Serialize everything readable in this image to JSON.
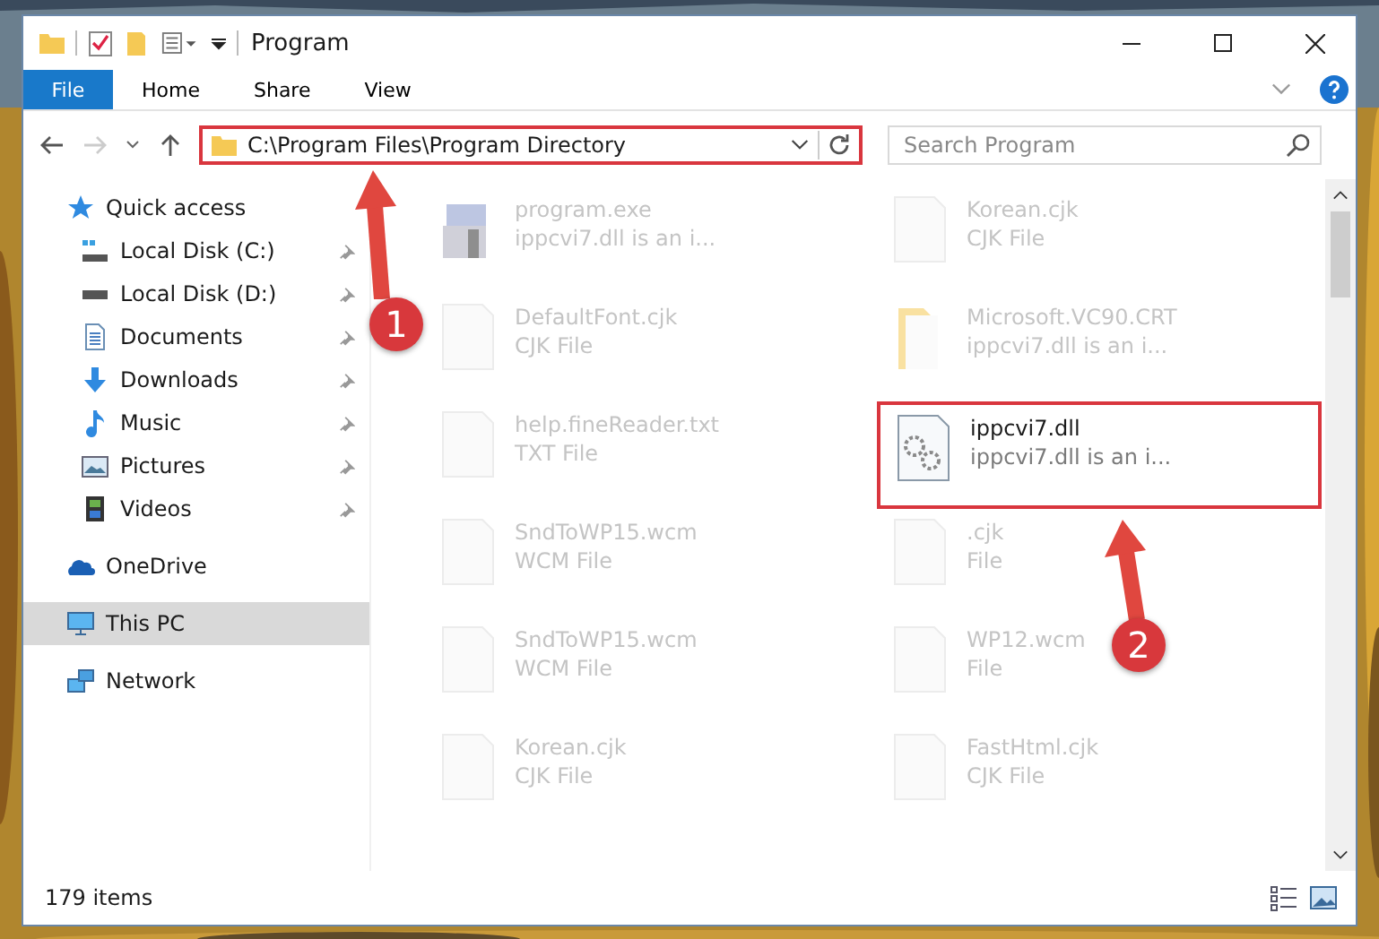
{
  "window": {
    "title": "Program"
  },
  "ribbon": {
    "file_tab": "File",
    "tabs": [
      {
        "label": "Home",
        "selected": false
      },
      {
        "label": "Share",
        "selected": false
      },
      {
        "label": "View",
        "selected": false
      }
    ]
  },
  "address_bar": {
    "path": "C:\\Program Files\\Program Directory",
    "highlighted": true
  },
  "search": {
    "placeholder": "Search Program"
  },
  "sidebar": {
    "items": [
      {
        "label": "Quick access",
        "kind": "star",
        "pinned": false,
        "selected": false,
        "children": [
          {
            "label": "Local Disk (C:)",
            "kind": "disk-c",
            "pinned": true,
            "selected": false
          },
          {
            "label": "Local Disk (D:)",
            "kind": "disk",
            "pinned": true,
            "selected": false
          },
          {
            "label": "Documents",
            "kind": "docs",
            "pinned": true,
            "selected": false
          },
          {
            "label": "Downloads",
            "kind": "download",
            "pinned": true,
            "selected": false
          },
          {
            "label": "Music",
            "kind": "music",
            "pinned": true,
            "selected": false
          },
          {
            "label": "Pictures",
            "kind": "pictures",
            "pinned": true,
            "selected": false
          },
          {
            "label": "Videos",
            "kind": "videos",
            "pinned": true,
            "selected": false
          }
        ]
      },
      {
        "label": "OneDrive",
        "kind": "cloud",
        "pinned": false,
        "selected": false
      },
      {
        "label": "This PC",
        "kind": "pc",
        "pinned": false,
        "selected": true
      },
      {
        "label": "Network",
        "kind": "network",
        "pinned": false,
        "selected": false
      }
    ]
  },
  "files": [
    {
      "name": "program.exe",
      "description": "ippcvi7.dll is an i...",
      "kind": "exe",
      "faded": true,
      "highlighted": false
    },
    {
      "name": "Korean.cjk",
      "description": "CJK File",
      "kind": "doc",
      "faded": true,
      "highlighted": false
    },
    {
      "name": "DefaultFont.cjk",
      "description": "CJK File",
      "kind": "doc",
      "faded": true,
      "highlighted": false
    },
    {
      "name": "Microsoft.VC90.CRT",
      "description": "ippcvi7.dll is an i...",
      "kind": "folder",
      "faded": true,
      "highlighted": false
    },
    {
      "name": "help.fineReader.txt",
      "description": "TXT File",
      "kind": "doc",
      "faded": true,
      "highlighted": false
    },
    {
      "name": "ippcvi7.dll",
      "description": "ippcvi7.dll is an i...",
      "kind": "dll",
      "faded": false,
      "highlighted": true
    },
    {
      "name": "SndToWP15.wcm",
      "description": "WCM File",
      "kind": "doc",
      "faded": true,
      "highlighted": false
    },
    {
      "name": ".cjk",
      "description": "File",
      "kind": "doc",
      "faded": true,
      "highlighted": false
    },
    {
      "name": "SndToWP15.wcm",
      "description": "WCM File",
      "kind": "doc",
      "faded": true,
      "highlighted": false
    },
    {
      "name": "WP12.wcm",
      "description": "File",
      "kind": "doc",
      "faded": true,
      "highlighted": false
    },
    {
      "name": "Korean.cjk",
      "description": "CJK File",
      "kind": "doc",
      "faded": true,
      "highlighted": false
    },
    {
      "name": "FastHtml.cjk",
      "description": "CJK File",
      "kind": "doc",
      "faded": true,
      "highlighted": false
    }
  ],
  "status_bar": {
    "count": "179 items"
  },
  "annotations": [
    {
      "number": "1"
    },
    {
      "number": "2"
    }
  ]
}
